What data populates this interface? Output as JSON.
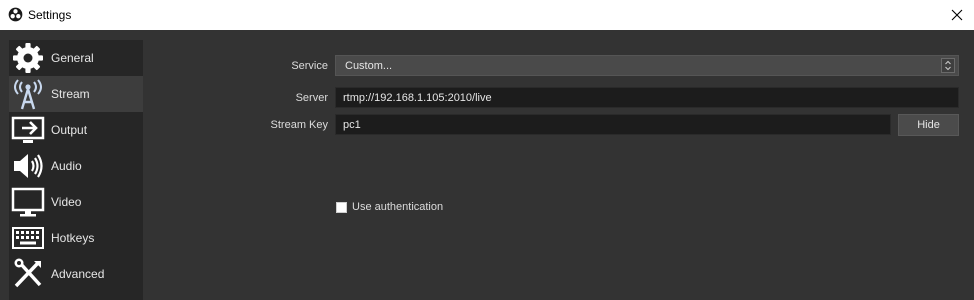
{
  "window": {
    "title": "Settings",
    "app_icon": "obs-icon",
    "close_icon": "close-icon"
  },
  "sidebar": {
    "selected": "Stream",
    "items": [
      {
        "label": "General",
        "icon": "gear-icon"
      },
      {
        "label": "Stream",
        "icon": "broadcast-antenna-icon"
      },
      {
        "label": "Output",
        "icon": "output-monitor-icon"
      },
      {
        "label": "Audio",
        "icon": "speaker-icon"
      },
      {
        "label": "Video",
        "icon": "monitor-icon"
      },
      {
        "label": "Hotkeys",
        "icon": "keyboard-icon"
      },
      {
        "label": "Advanced",
        "icon": "tools-icon"
      }
    ]
  },
  "stream": {
    "service_label": "Service",
    "service_value": "Custom...",
    "server_label": "Server",
    "server_value": "rtmp://192.168.1.105:2010/live",
    "stream_key_label": "Stream Key",
    "stream_key_value": "pc1",
    "hide_button": "Hide",
    "use_auth_label": "Use authentication",
    "use_auth_checked": false
  },
  "colors": {
    "background": "#333333",
    "sidebar": "#262626",
    "selected_item": "#3d3d3d",
    "input_bg": "#1c1c1c",
    "text": "#e6e6e6"
  }
}
